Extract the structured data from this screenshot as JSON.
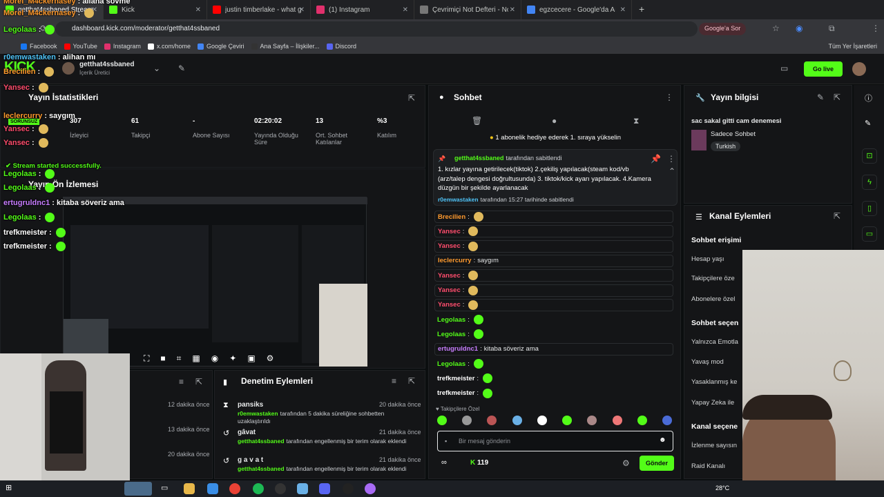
{
  "browser": {
    "tabs": [
      {
        "label": "getthat4ssbaned Stream - Kick",
        "color": "#53fc18",
        "active": true
      },
      {
        "label": "Kick",
        "color": "#53fc18",
        "active": false
      },
      {
        "label": "justin timberlake - what goes a",
        "color": "#ff0000",
        "active": false
      },
      {
        "label": "(1) Instagram",
        "color": "#e1306c",
        "active": false
      },
      {
        "label": "Çevrimiçi Not Defteri - Notlarınız",
        "color": "#777777",
        "active": false
      },
      {
        "label": "egzcecere - Google'da Ara",
        "color": "#4285f4",
        "active": false
      }
    ],
    "url": "dashboard.kick.com/moderator/getthat4ssbaned",
    "google_btn": "Google'a Sor",
    "bookmarks": [
      "Facebook",
      "YouTube",
      "Instagram",
      "x.com/home",
      "Google Çeviri",
      "Ana Sayfa – İlişkiler...",
      "Discord"
    ],
    "all_bookmarks": "Tüm Yer İşaretleri"
  },
  "header": {
    "username": "getthat4ssbaned",
    "role": "İçerik Üretici",
    "go_live": "Go live"
  },
  "stats": {
    "title": "Yayın İstatistikleri",
    "items": [
      {
        "value": "307",
        "label": "İzleyici"
      },
      {
        "value": "61",
        "label": "Takipçi"
      },
      {
        "value": "-",
        "label": "Abone Sayısı"
      },
      {
        "value": "02:20:02",
        "label": "Yayında Olduğu Süre"
      },
      {
        "value": "13",
        "label": "Ort. Sohbet Katılanlar"
      },
      {
        "value": "%3",
        "label": "Katılım"
      }
    ]
  },
  "preview": {
    "title": "Yayın Ön İzlemesi"
  },
  "left_panel_times": [
    "12 dakika önce",
    "13 dakika önce",
    "20 dakika önce"
  ],
  "mod_actions": {
    "title": "Denetim Eylemleri",
    "rows": [
      {
        "name": "pansiks",
        "time": "20 dakika önce",
        "actor": "r0emwastaken",
        "text": "tarafından 5 dakika süreliğine sohbetten uzaklaştırıldı"
      },
      {
        "name": "gâvat",
        "time": "21 dakika önce",
        "actor": "getthat4ssbaned",
        "text": "tarafından engellenmiş bir terim olarak eklendi"
      },
      {
        "name": "g a v a t",
        "time": "21 dakika önce",
        "actor": "getthat4ssbaned",
        "text": "tarafından engellenmiş bir terim olarak eklendi"
      }
    ]
  },
  "chat": {
    "title": "Sohbet",
    "gift_banner": "1 abonelik hediye ederek 1. sıraya yükselin",
    "pinned": {
      "author": "getthat4ssbaned",
      "pinned_label": "tarafından sabitlendi",
      "text": "1. kızlar yayına getirilecek(tiktok) 2.çekiliş yapılacak(steam kod/vb (arz/talep dengesi doğrultusunda) 3. tiktok/kick ayarı yapılacak. 4.Kamera düzgün bir şekilde ayarlanacak",
      "footer_user": "r0emwastaken",
      "footer_text": "tarafından 15:27 tarihinde sabitlendi"
    },
    "messages": [
      {
        "user": "Brecilien",
        "color": "#ff9a2e",
        "text": ""
      },
      {
        "user": "Yansec",
        "color": "#ff4d6d",
        "text": ""
      },
      {
        "user": "Yansec",
        "color": "#ff4d6d",
        "text": ""
      },
      {
        "user": "leclercurry",
        "color": "#ff9a2e",
        "text": "saygım"
      },
      {
        "user": "Yansec",
        "color": "#ff4d6d",
        "text": ""
      },
      {
        "user": "Yansec",
        "color": "#ff4d6d",
        "text": ""
      },
      {
        "user": "Yansec",
        "color": "#ff4d6d",
        "text": ""
      },
      {
        "user": "Legolaas",
        "color": "#53fc18",
        "text": ""
      },
      {
        "user": "Legolaas",
        "color": "#53fc18",
        "text": ""
      },
      {
        "user": "ertugruldnc1",
        "color": "#c77dff",
        "text": "kitaba söveriz ama"
      },
      {
        "user": "Legolaas",
        "color": "#53fc18",
        "text": ""
      },
      {
        "user": "trefkmeister",
        "color": "#ffffff",
        "text": ""
      },
      {
        "user": "trefkmeister",
        "color": "#ffffff",
        "text": ""
      }
    ],
    "followers_only": "Takipçilere Özel",
    "placeholder": "Bir mesaj gönderin",
    "points": "119",
    "send": "Gönder"
  },
  "stream_info": {
    "title": "Yayın bilgisi",
    "stream_title": "sac sakal gitti cam denemesi",
    "category": "Sadece Sohbet",
    "tag": "Turkish"
  },
  "channel_actions": {
    "title": "Kanal Eylemleri",
    "items": [
      {
        "text": "Sohbet erişimi",
        "bold": true
      },
      {
        "text": "Hesap yaşı",
        "bold": false
      },
      {
        "text": "Takipçilere öze",
        "bold": false
      },
      {
        "text": "Abonelere özel",
        "bold": false
      },
      {
        "text": "Sohbet seçen",
        "bold": true
      },
      {
        "text": "Yalnızca Emotla",
        "bold": false
      },
      {
        "text": "Yavaş mod",
        "bold": false
      },
      {
        "text": "Yasaklanmış ke",
        "bold": false
      },
      {
        "text": "Yapay Zeka ile",
        "bold": false
      },
      {
        "text": "Kanal seçene",
        "bold": true
      },
      {
        "text": "İzlenme sayısın",
        "bold": false
      },
      {
        "text": "Raid Kanalı",
        "bold": false
      }
    ]
  },
  "overlay_chat": [
    {
      "user": "Morel_M4ckernasey",
      "color": "#ff9a2e",
      "text": "allana sövme"
    },
    {
      "user": "Morel_M4ckernasey",
      "color": "#ff9a2e",
      "text": ""
    },
    {
      "user": "Legolaas",
      "color": "#53fc18",
      "text": ""
    },
    {
      "user": "r0emwastaken",
      "color": "#4fc3f7",
      "text": "alihan mı"
    },
    {
      "user": "Brecilien",
      "color": "#ff9a2e",
      "text": ""
    },
    {
      "user": "Yansec",
      "color": "#ff4d6d",
      "text": ""
    },
    {
      "user": "leclercurry",
      "color": "#ff9a2e",
      "text": "saygım"
    },
    {
      "user": "Yansec",
      "color": "#ff4d6d",
      "text": ""
    },
    {
      "user": "Yansec",
      "color": "#ff4d6d",
      "text": ""
    },
    {
      "user": "Legolaas",
      "color": "#53fc18",
      "text": ""
    },
    {
      "user": "Legolaas",
      "color": "#53fc18",
      "text": ""
    },
    {
      "user": "ertugruldnc1",
      "color": "#c77dff",
      "text": "kitaba söveriz ama"
    },
    {
      "user": "Legolaas",
      "color": "#53fc18",
      "text": ""
    },
    {
      "user": "trefkmeister",
      "color": "#ffffff",
      "text": ""
    },
    {
      "user": "trefkmeister",
      "color": "#ffffff",
      "text": ""
    }
  ],
  "overlay_status": "Stream started successfully.",
  "overlay_badge": "SORUNSUZ",
  "taskbar": {
    "weather": "28°C"
  }
}
